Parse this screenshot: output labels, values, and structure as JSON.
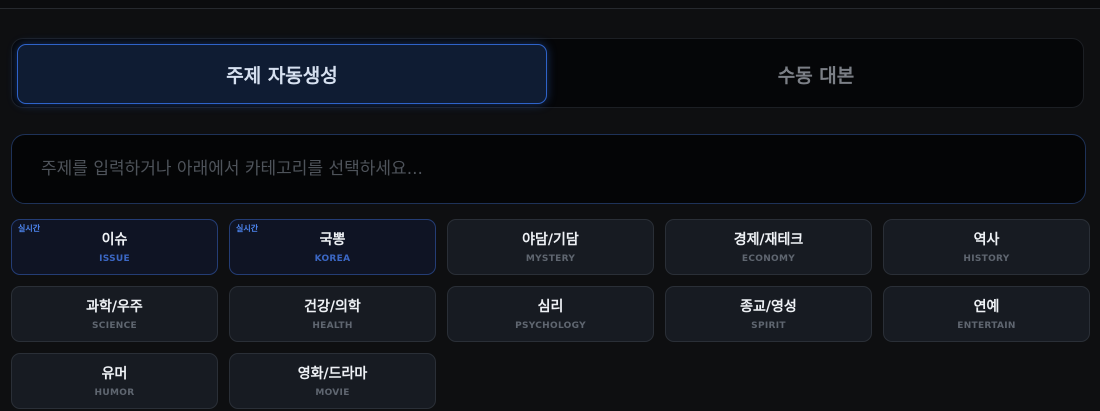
{
  "tabs": {
    "auto_topic": "주제 자동생성",
    "manual_script": "수동 대본"
  },
  "search": {
    "placeholder": "주제를 입력하거나 아래에서 카테고리를 선택하세요..."
  },
  "live_badge": "실시간",
  "categories": [
    {
      "label": "이슈",
      "sub": "ISSUE",
      "live": true
    },
    {
      "label": "국뽕",
      "sub": "KOREA",
      "live": true
    },
    {
      "label": "야담/기담",
      "sub": "MYSTERY",
      "live": false
    },
    {
      "label": "경제/재테크",
      "sub": "ECONOMY",
      "live": false
    },
    {
      "label": "역사",
      "sub": "HISTORY",
      "live": false
    },
    {
      "label": "과학/우주",
      "sub": "SCIENCE",
      "live": false
    },
    {
      "label": "건강/의학",
      "sub": "HEALTH",
      "live": false
    },
    {
      "label": "심리",
      "sub": "PSYCHOLOGY",
      "live": false
    },
    {
      "label": "종교/영성",
      "sub": "SPIRIT",
      "live": false
    },
    {
      "label": "연예",
      "sub": "ENTERTAIN",
      "live": false
    },
    {
      "label": "유머",
      "sub": "HUMOR",
      "live": false
    },
    {
      "label": "영화/드라마",
      "sub": "MOVIE",
      "live": false
    }
  ],
  "colors": {
    "accent": "#2e63c9",
    "background": "#0e0f11",
    "card": "#171b22"
  }
}
